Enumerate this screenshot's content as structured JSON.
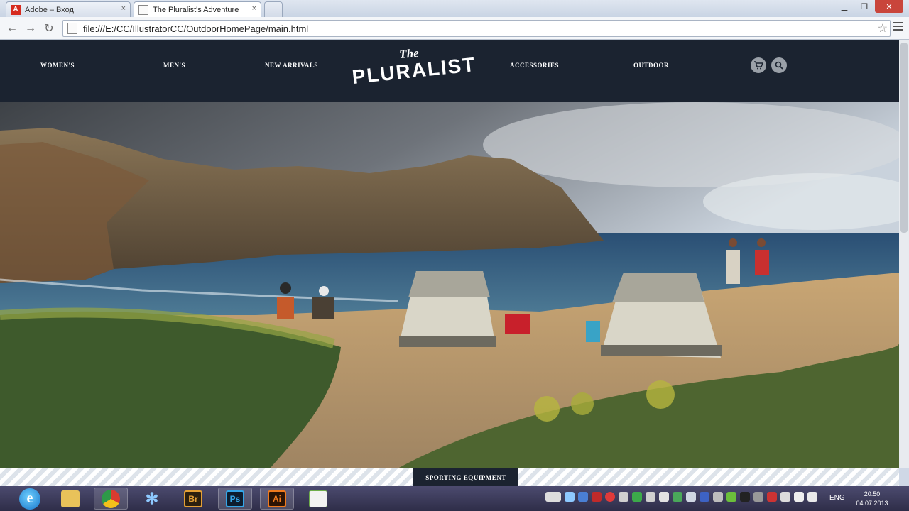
{
  "browser": {
    "tabs": [
      {
        "title": "Adobe – Вход",
        "close": "×"
      },
      {
        "title": "The Pluralist's Adventure",
        "close": "×"
      }
    ],
    "address": "file:///E:/CC/IllustratorCC/OutdoorHomePage/main.html",
    "back_icon": "back-arrow-icon",
    "forward_icon": "forward-arrow-icon",
    "reload_icon": "reload-icon",
    "star_icon": "bookmark-star-icon"
  },
  "site": {
    "nav_left": [
      "WOMEN'S",
      "MEN'S",
      "NEW ARRIVALS"
    ],
    "nav_right": [
      "ACCESSORIES",
      "OUTDOOR"
    ],
    "logo_small": "The",
    "logo_big": "PLURALIST",
    "cart_icon": "cart-icon",
    "search_icon": "search-icon",
    "band_label": "SPORTING EQUIPMENT",
    "colors": {
      "nav_bg": "#1b2330",
      "band_stripe": "#dde3ea"
    }
  },
  "taskbar": {
    "apps": [
      {
        "label": "Internet Explorer",
        "glyph": "e"
      },
      {
        "label": "File Explorer",
        "glyph": ""
      },
      {
        "label": "Chrome",
        "glyph": ""
      },
      {
        "label": "Snowflake app",
        "glyph": "✻"
      },
      {
        "label": "Bridge",
        "glyph": "Br"
      },
      {
        "label": "Photoshop",
        "glyph": "Ps"
      },
      {
        "label": "Illustrator",
        "glyph": "Ai"
      },
      {
        "label": "Image viewer",
        "glyph": ""
      }
    ],
    "lang": "ENG",
    "time": "20:50",
    "date": "04.07.2013"
  }
}
